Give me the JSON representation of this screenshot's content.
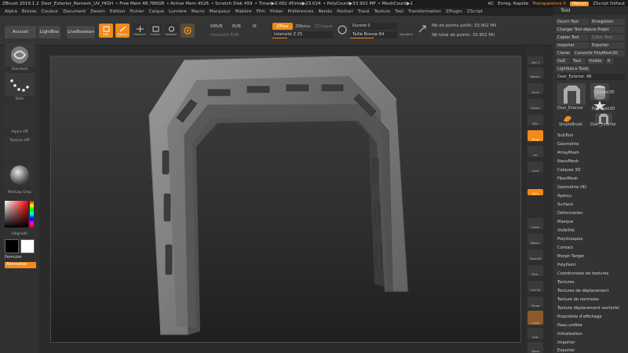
{
  "titlebar": {
    "app": "ZBrush 2019.1.2",
    "doc": "Door_Exterior_Remesh_UV_HIGH",
    "free_mem": "• Free Mem 48.786GB",
    "active_mem": "• Active Mem 4526",
    "scratch": "• Scratch Disk 459",
    "timer": "• Timer▶0.002 ATime▶23.024",
    "polycount": "• PolyCount▶33.902 MP",
    "meshcount": "• MeshCount▶1",
    "ac": "AC",
    "quicksave": "Enreg. Rapide",
    "transparence": "Transparence 0",
    "menus": "Menus",
    "zscript": "ZScript Défaut"
  },
  "menubar": [
    "Alpha",
    "Brosse",
    "Couleur",
    "Document",
    "Dessin",
    "Edition",
    "Fichier",
    "Calque",
    "Lumière",
    "Macro",
    "Marqueur",
    "Matière",
    "Film",
    "Picker",
    "Préférences",
    "Rendu",
    "Pochoir",
    "Tracé",
    "Texture",
    "Tool",
    "Transformation",
    "ZPlugin",
    "ZScript"
  ],
  "toolbar": {
    "home": "Accueil",
    "lightbox": "LightBox",
    "liveboolean": "LiveBoolean",
    "edit": "Edit",
    "draw": "Dessin",
    "move": "Déplacer",
    "scale": "Echelle",
    "rotate": "Rotation",
    "mrgb": "MRVB",
    "rgb": "RVB",
    "m": "M",
    "rgb_intensity": "Intensité RVB",
    "zadd": "ZPlus",
    "zsub": "ZMoins",
    "zcut": "ZCouper",
    "z_intensity": "Intensité Z 25",
    "focal": "Dureté 0",
    "draw_size": "Taille Brosse 64",
    "dynamic": "Dynamic",
    "active_points": "Nb de points actifs: 33.902 Mil",
    "total_points": "Nb total de points: 33.902 Mil"
  },
  "lefttray": {
    "brush": "Standard",
    "stroke": "Dots",
    "alpha": "Alpha Off",
    "texture": "Texture Off",
    "material": "MatCap Gray",
    "gradient": "Dégradé",
    "switch": "Permuter",
    "alternate": "Alternative"
  },
  "rightshelf": [
    "Spix 3",
    "Déplac.",
    "Zoom",
    "Pivoter",
    "Réel",
    "Persp",
    "Sol",
    "Local",
    "Sym",
    "Cadrer",
    "Déplac.",
    "Zoom3D",
    "Pivot.",
    "Line Fill",
    "Transp",
    "Ghost",
    "Solo",
    "Xpose"
  ],
  "toolpanel": {
    "title": "Tool",
    "load_tool": "Ouvrir Tool",
    "save_as": "Enregistrer",
    "load_from_project": "Charger Tool depuis Projet",
    "copy_tool": "Copier Tool",
    "paste_tool": "Coller Tool",
    "import": "Importer",
    "export": "Exporter",
    "clone": "Cloner",
    "make_polymesh": "Convertir PolyMesh3D",
    "goz": "GoZ",
    "all": "Tout",
    "visible": "Visible",
    "r": "R",
    "lightbox_tools": "Lightbox ▸ Tools",
    "current_tool": "Door_Exterior. 48",
    "thumbs": [
      "Door_Exterior",
      "Cylinder3D",
      "PolyMesh3D",
      "SimpleBrush",
      "Door_Exterior"
    ],
    "sections": [
      "SubTool",
      "Géométrie",
      "ArrayMesh",
      "NanoMesh",
      "Calques 3D",
      "FiberMesh",
      "Géométrie HD",
      "Aperçu",
      "Surface",
      "Déformation",
      "Masque",
      "Visibilité",
      "PolyGroupes",
      "Contact",
      "Morph Target",
      "PolyPaint",
      "Coordonnées de textures",
      "Textures",
      "Textures de déplacement",
      "Texture de normales",
      "Texture déplacement vectoriel",
      "Propriétés d'affichage",
      "Peau unifiée",
      "Initialisation",
      "Importer",
      "Exporter"
    ]
  },
  "colors": {
    "accent": "#f08a1c",
    "bg": "#2b2b2b"
  }
}
